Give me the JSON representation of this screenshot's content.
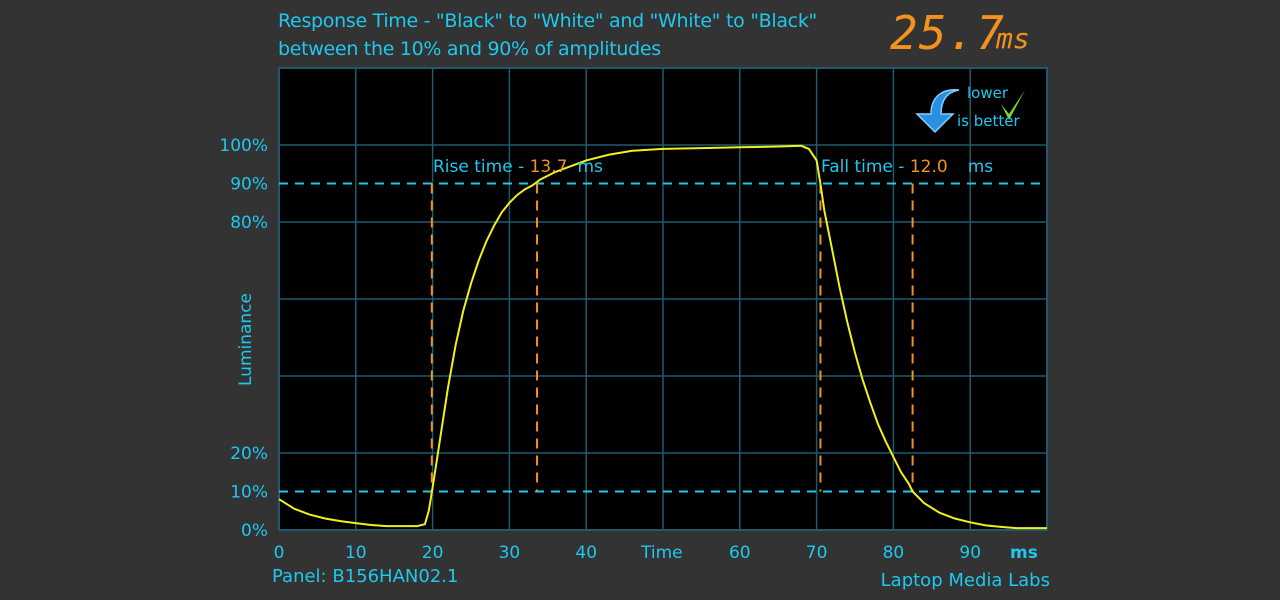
{
  "header": {
    "title_line1": "Response Time - \"Black\" to \"White\" and \"White\" to \"Black\"",
    "title_line2": "between the 10% and 90% of amplitudes",
    "total_value": "25.7",
    "total_unit": "ms"
  },
  "badge": {
    "line1": "lower",
    "line2": "is better"
  },
  "footer": {
    "panel": "Panel: B156HAN02.1",
    "brand": "Laptop Media Labs"
  },
  "colors": {
    "accent": "#1ec8ee",
    "orange": "#f5921e",
    "curve": "#f2f01a",
    "grid": "#1d5a6e",
    "plot_bg": "#000000"
  },
  "chart_data": {
    "type": "line",
    "title": "Response Time - \"Black\" to \"White\" and \"White\" to \"Black\" between the 10% and 90% of amplitudes",
    "xlabel": "Time",
    "xunit": "ms",
    "ylabel": "Luminance",
    "xlim": [
      0,
      100
    ],
    "ylim": [
      0,
      100
    ],
    "xticks": [
      0,
      10,
      20,
      30,
      40,
      60,
      70,
      80,
      90
    ],
    "xtick_labels": [
      "0",
      "10",
      "20",
      "30",
      "40",
      "60",
      "70",
      "80",
      "90"
    ],
    "yticks": [
      0,
      10,
      20,
      80,
      90,
      100
    ],
    "ytick_labels": [
      "0%",
      "10%",
      "20%",
      "80%",
      "90%",
      "100%"
    ],
    "grid": true,
    "thresholds": [
      10,
      90
    ],
    "rise": {
      "label": "Rise time - ",
      "value": "13.7",
      "unit": "ms",
      "start_ms": 19.9,
      "end_ms": 33.6
    },
    "fall": {
      "label": "Fall time - ",
      "value": "12.0",
      "unit": "ms",
      "start_ms": 70.5,
      "end_ms": 82.5
    },
    "series": [
      {
        "name": "Luminance",
        "x": [
          0,
          2,
          4,
          6,
          8,
          10,
          12,
          14,
          16,
          18,
          19,
          19.5,
          20,
          21,
          22,
          23,
          24,
          25,
          26,
          27,
          28,
          29,
          30,
          31,
          32,
          33,
          34,
          36,
          38,
          40,
          43,
          46,
          50,
          55,
          60,
          65,
          68,
          69,
          70,
          70.5,
          71,
          72,
          73,
          74,
          75,
          76,
          77,
          78,
          79,
          80,
          81,
          82,
          82.5,
          84,
          86,
          88,
          90,
          92,
          94,
          96,
          100
        ],
        "y": [
          8,
          5.5,
          4,
          3,
          2.3,
          1.8,
          1.3,
          1,
          1,
          1,
          1.5,
          5,
          11,
          24,
          37,
          48,
          57,
          64,
          70,
          75,
          79,
          82.5,
          85,
          87,
          88.5,
          89.5,
          91,
          93,
          94.5,
          96,
          97.5,
          98.5,
          99,
          99.2,
          99.4,
          99.6,
          99.8,
          99,
          96,
          90,
          83,
          73,
          63,
          54,
          46,
          39,
          33,
          27.5,
          23,
          19,
          15,
          12,
          10,
          7,
          4.5,
          3,
          2,
          1.2,
          0.8,
          0.5,
          0.5
        ]
      }
    ]
  }
}
